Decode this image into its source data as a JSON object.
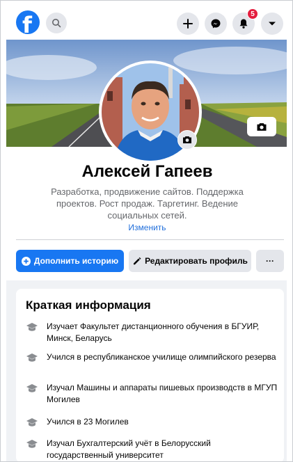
{
  "topbar": {
    "logo": "f",
    "icons": [
      "search-icon",
      "plus-icon",
      "messenger-icon",
      "bell-icon",
      "caret-down-icon"
    ],
    "notifications_count": "5"
  },
  "profile": {
    "name": "Алексей Гапеев",
    "bio": "Разработка, продвижение сайтов. Поддержка проектов. Рост продаж. Таргетинг. Ведение социальных сетей.",
    "edit_bio": "Изменить"
  },
  "actions": {
    "add_story": "Дополнить историю",
    "edit_profile": "Редактировать профиль",
    "more": "···"
  },
  "intro": {
    "title": "Краткая информация",
    "items": [
      "Изучает Факультет дистанционного обучения в БГУИР, Минск, Беларусь",
      "Учился в республиканское училище олимпийского резерва",
      "Изучал Машины и аппараты пишевых производств в МГУП Могилев",
      "Учился в 23 Могилев",
      "Изучал Бухгалтерский учёт в Белорусский государственный университет"
    ]
  },
  "colors": {
    "accent": "#1877f2",
    "button_gray": "#e4e6eb",
    "badge": "#e41e3f",
    "link": "#216fdb"
  }
}
